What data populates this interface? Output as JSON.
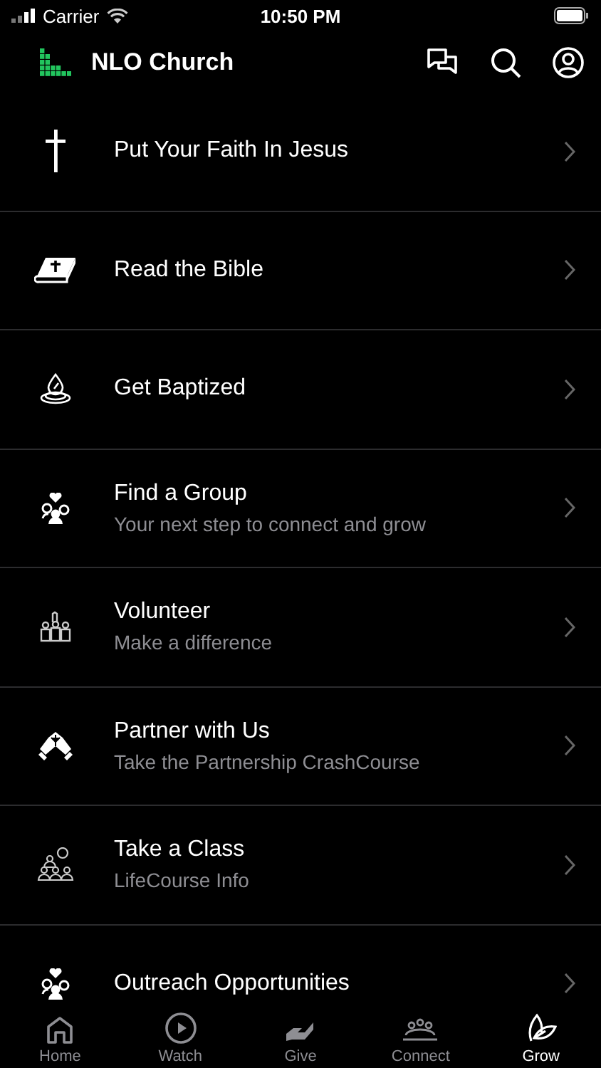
{
  "status_bar": {
    "carrier": "Carrier",
    "time": "10:50 PM"
  },
  "header": {
    "title": "NLO Church"
  },
  "items": [
    {
      "title": "Put Your Faith In Jesus"
    },
    {
      "title": "Read the Bible"
    },
    {
      "title": "Get Baptized"
    },
    {
      "title": "Find a Group",
      "subtitle": "Your next step to connect and grow"
    },
    {
      "title": "Volunteer",
      "subtitle": "Make a difference"
    },
    {
      "title": "Partner with Us",
      "subtitle": "Take the Partnership CrashCourse"
    },
    {
      "title": "Take a Class",
      "subtitle": "LifeCourse Info"
    },
    {
      "title": "Outreach Opportunities"
    }
  ],
  "tabs": [
    {
      "label": "Home",
      "selected": false
    },
    {
      "label": "Watch",
      "selected": false
    },
    {
      "label": "Give",
      "selected": false
    },
    {
      "label": "Connect",
      "selected": false
    },
    {
      "label": "Grow",
      "selected": true
    }
  ]
}
